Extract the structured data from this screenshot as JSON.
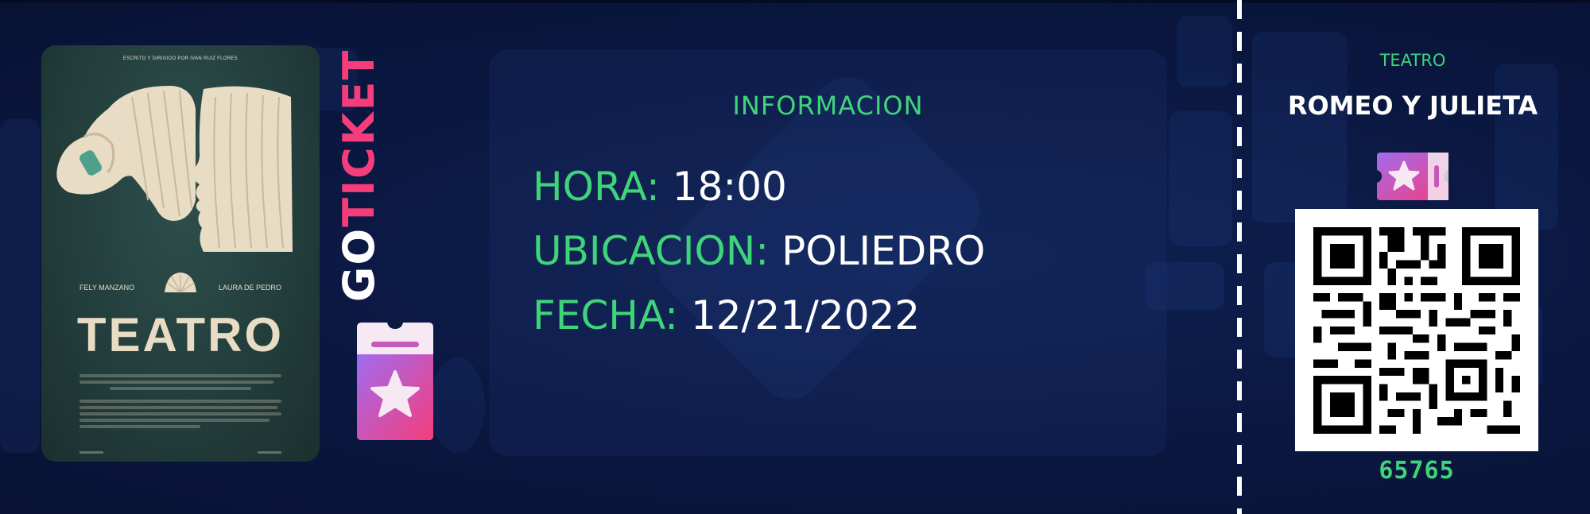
{
  "brand": {
    "part1": "GO",
    "part2": "TICKET",
    "accent": "#f53d7b"
  },
  "poster": {
    "credit": "ESCRITO Y DIRIGIDO POR IVAN RUIZ FLORES",
    "actor_left": "FELY MANZANO",
    "actor_right": "LAURA DE PEDRO",
    "title": "TEATRO"
  },
  "info": {
    "title": "INFORMACION",
    "rows": [
      {
        "label": "HORA:",
        "value": "18:00"
      },
      {
        "label": "UBICACION:",
        "value": "POLIEDRO"
      },
      {
        "label": "FECHA:",
        "value": "12/21/2022"
      }
    ]
  },
  "stub": {
    "category": "TEATRO",
    "title": "ROMEO Y JULIETA",
    "code": "65765"
  },
  "icons": {
    "ticket_left": "ticket-star-icon",
    "ticket_stub": "ticket-star-icon",
    "qr": "qr-code-icon"
  },
  "colors": {
    "background": "#0a1638",
    "label_green": "#3fd47a",
    "text_white": "#ffffff"
  }
}
